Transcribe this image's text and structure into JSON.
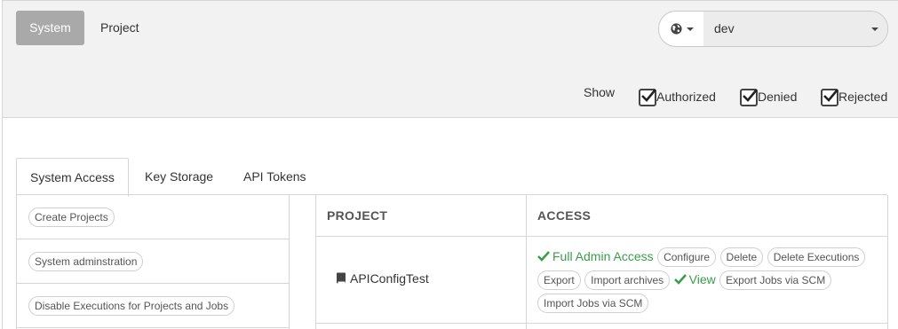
{
  "topbar": {
    "system_label": "System",
    "project_label": "Project",
    "environment": {
      "value": "dev",
      "globe_icon": "globe-icon"
    }
  },
  "filter": {
    "show_label": "Show",
    "options": [
      {
        "label": "Authorized",
        "checked": true
      },
      {
        "label": "Denied",
        "checked": true
      },
      {
        "label": "Rejected",
        "checked": true
      }
    ]
  },
  "tabs": [
    {
      "label": "System Access",
      "active": true
    },
    {
      "label": "Key Storage",
      "active": false
    },
    {
      "label": "API Tokens",
      "active": false
    }
  ],
  "system_access": [
    "Create Projects",
    "System adminstration",
    "Disable Executions for Projects and Jobs"
  ],
  "table": {
    "headers": {
      "project": "PROJECT",
      "access": "ACCESS"
    },
    "rows": [
      {
        "project": "APIConfigTest",
        "access": [
          {
            "label": "Full Admin Access",
            "granted": true
          },
          {
            "label": "Configure",
            "granted": false
          },
          {
            "label": "Delete",
            "granted": false
          },
          {
            "label": "Delete Executions",
            "granted": false
          },
          {
            "label": "Export",
            "granted": false
          },
          {
            "label": "Import archives",
            "granted": false
          },
          {
            "label": "View",
            "granted": true
          },
          {
            "label": "Export Jobs via SCM",
            "granted": false
          },
          {
            "label": "Import Jobs via SCM",
            "granted": false
          }
        ]
      }
    ]
  },
  "colors": {
    "granted": "#3a9d4a",
    "system_button": "#a9a9a9"
  }
}
